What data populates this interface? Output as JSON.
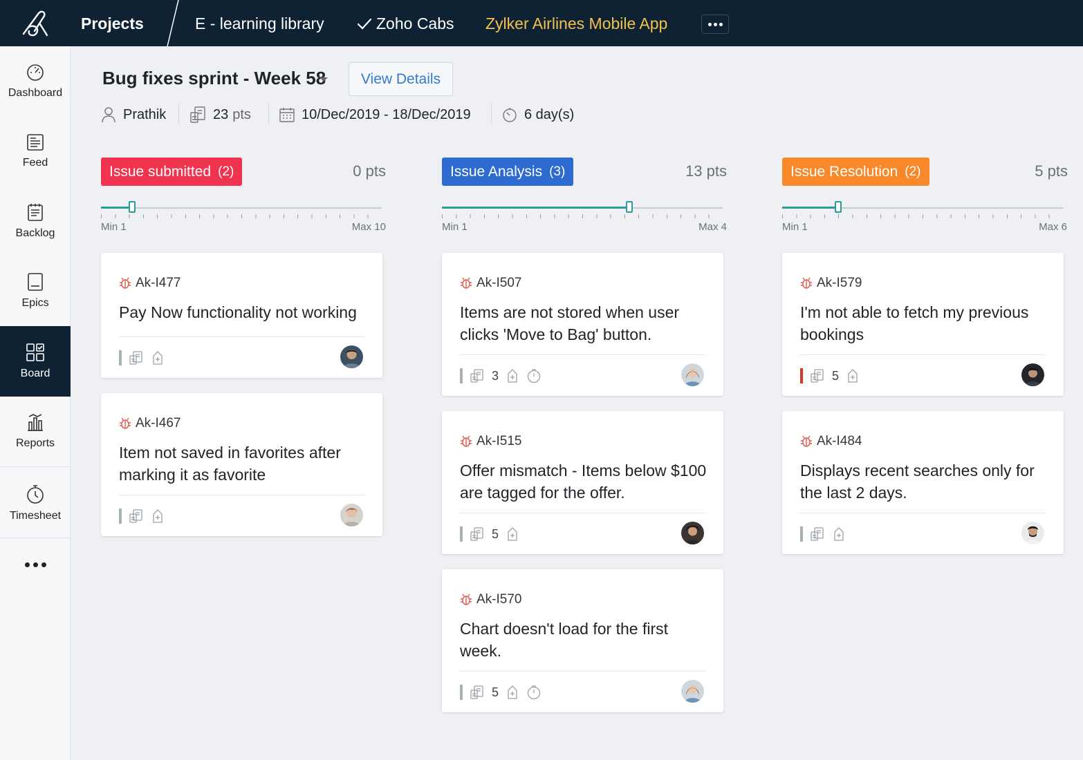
{
  "topbar": {
    "projects_label": "Projects",
    "tabs": [
      {
        "label": "E - learning library"
      },
      {
        "label": "Zoho Cabs"
      },
      {
        "label": "Zylker Airlines Mobile App"
      }
    ],
    "active_color": "#f2c14e"
  },
  "sidebar": {
    "items": [
      {
        "label": "Dashboard",
        "icon": "dashboard-gauge-icon"
      },
      {
        "label": "Feed",
        "icon": "feed-icon"
      },
      {
        "label": "Backlog",
        "icon": "backlog-icon"
      },
      {
        "label": "Epics",
        "icon": "epics-icon"
      },
      {
        "label": "Board",
        "icon": "board-icon"
      },
      {
        "label": "Reports",
        "icon": "reports-icon"
      },
      {
        "label": "Timesheet",
        "icon": "timesheet-icon"
      }
    ],
    "active": "Board"
  },
  "sprint": {
    "title": "Bug fixes sprint - Week 58",
    "view_details": "View Details",
    "owner": "Prathik",
    "points": "23",
    "points_unit": "pts",
    "start": "10/Dec/2019",
    "separator": "-",
    "end": "18/Dec/2019",
    "duration": "6 day(s)"
  },
  "columns": [
    {
      "name": "Issue submitted",
      "count": "(2)",
      "pts": "0 pts",
      "color": "#f0344f",
      "slider": {
        "min": "Min 1",
        "max": "Max 10",
        "value": 2,
        "min_value": 1,
        "max_value": 10
      },
      "cards": [
        {
          "id": "Ak-I477",
          "title": "Pay Now functionality not working",
          "points": "",
          "timer": false,
          "priority": "normal"
        },
        {
          "id": "Ak-I467",
          "title": "Item not saved in favorites after marking it as favorite",
          "points": "",
          "timer": false,
          "priority": "normal"
        }
      ]
    },
    {
      "name": "Issue Analysis",
      "count": "(3)",
      "pts": "13 pts",
      "color": "#2e6bd1",
      "slider": {
        "min": "Min 1",
        "max": "Max 4",
        "value": 3,
        "min_value": 1,
        "max_value": 4
      },
      "cards": [
        {
          "id": "Ak-I507",
          "title": "Items are not stored when user clicks 'Move to Bag' button.",
          "points": "3",
          "timer": true,
          "priority": "normal"
        },
        {
          "id": "Ak-I515",
          "title": "Offer mismatch - Items below $100 are tagged for the offer.",
          "points": "5",
          "timer": false,
          "priority": "normal"
        },
        {
          "id": "Ak-I570",
          "title": "Chart doesn't load for the first week.",
          "points": "5",
          "timer": true,
          "priority": "normal"
        }
      ]
    },
    {
      "name": "Issue Resolution",
      "count": "(2)",
      "pts": "5 pts",
      "color": "#f7892a",
      "slider": {
        "min": "Min 1",
        "max": "Max 6",
        "value": 2,
        "min_value": 1,
        "max_value": 6
      },
      "cards": [
        {
          "id": "Ak-I579",
          "title": "I'm not able to fetch my previous bookings",
          "points": "5",
          "timer": false,
          "priority": "high"
        },
        {
          "id": "Ak-I484",
          "title": "Displays recent searches only for the last 2 days.",
          "points": "",
          "timer": false,
          "priority": "normal"
        }
      ]
    }
  ]
}
